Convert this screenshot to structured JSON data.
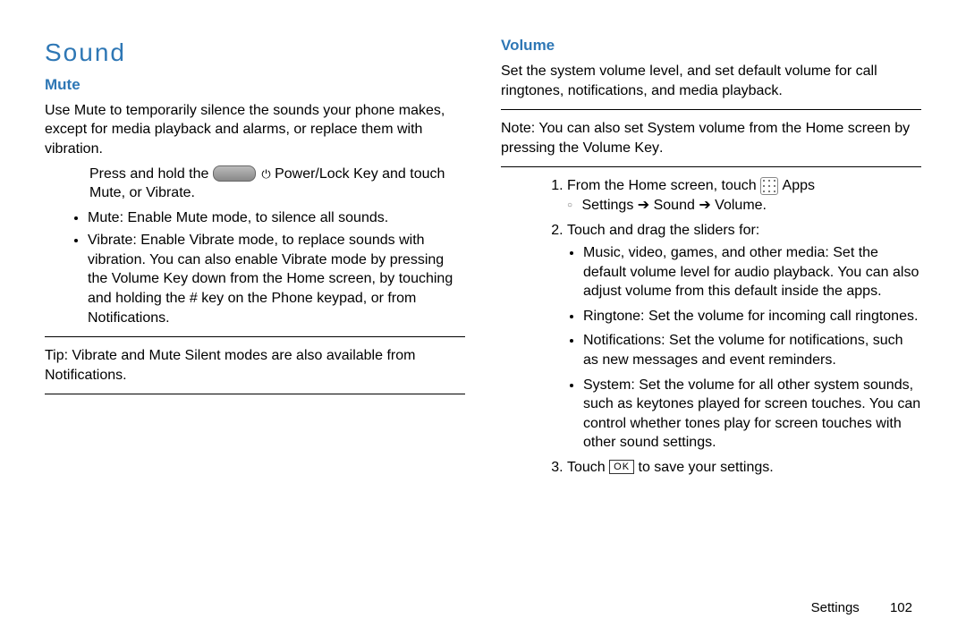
{
  "left": {
    "h1": "Sound",
    "mute": {
      "title": "Mute",
      "intro": "Use Mute to temporarily silence the sounds your phone makes, except for media playback and alarms, or replace them with vibration.",
      "press_prefix": "Press and hold the ",
      "power_key": " Power/Lock Key",
      "press_suffix": " and touch Mute, or Vibrate.",
      "bul1_term": "Mute",
      "bul1_text": ": Enable Mute mode, to silence all sounds.",
      "bul2_term": "Vibrate",
      "bul2_text": ": Enable Vibrate mode, to replace sounds with vibration. You can also enable Vibrate mode by pressing the Volume Key down from the Home screen, by touching and holding the # key on the Phone keypad, or from Notifications.",
      "tip_label": "Tip:",
      "tip_text": " Vibrate and Mute Silent modes are also available from Notifications."
    }
  },
  "right": {
    "volume": {
      "title": "Volume",
      "intro": "Set the system volume level, and set default volume for call ringtones, notifications, and media playback.",
      "note_label": "Note:",
      "note_text": " You can also set System volume from the Home screen by pressing the ",
      "note_key": "Volume Key",
      "note_end": ".",
      "step1_pre": "From the Home screen, touch ",
      "step1_apps": " Apps",
      "nav_settings": "Settings",
      "nav_sound": "Sound",
      "nav_volume": "Volume",
      "step2": "Touch and drag the sliders for:",
      "s2a_term": "Music, video, games, and other media",
      "s2a_text": ": Set the default volume level for audio playback. You can also adjust volume from this default inside the apps.",
      "s2b_term": "Ringtone",
      "s2b_text": ": Set the volume for incoming call ringtones.",
      "s2c_term": "Notifications",
      "s2c_text": ": Set the volume for notifications, such as new messages and event reminders.",
      "s2d_term": "System",
      "s2d_text": ": Set the volume for all other system sounds, such as keytones played for screen touches. You can control whether tones play for screen touches with other sound settings.",
      "step3_pre": "Touch ",
      "step3_ok": "OK",
      "step3_post": " to save your settings."
    }
  },
  "footer": {
    "section": "Settings",
    "page": "102"
  }
}
